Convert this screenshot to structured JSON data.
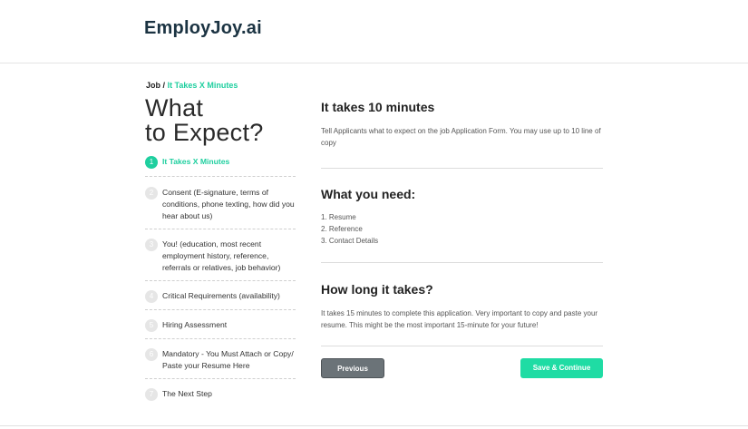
{
  "header": {
    "logo": "EmployJoy.ai"
  },
  "breadcrumb": {
    "parent": "Job",
    "separator": "/",
    "current": "It Takes X Minutes"
  },
  "page_title": {
    "line1": "What",
    "line2": "to Expect?"
  },
  "steps": [
    {
      "number": "1",
      "label": "It Takes X Minutes",
      "active": true
    },
    {
      "number": "2",
      "label": "Consent (E-signature, terms of conditions, phone texting, how  did you hear about us)",
      "active": false
    },
    {
      "number": "3",
      "label": "You! (education, most recent employment history, reference, referrals or relatives, job behavior)",
      "active": false
    },
    {
      "number": "4",
      "label": "Critical Requirements (availability)",
      "active": false
    },
    {
      "number": "5",
      "label": "Hiring Assessment",
      "active": false
    },
    {
      "number": "6",
      "label": "Mandatory - You Must Attach or Copy/ Paste your Resume Here",
      "active": false
    },
    {
      "number": "7",
      "label": "The Next Step",
      "active": false
    }
  ],
  "sections": {
    "time": {
      "title": "It takes 10 minutes",
      "body": "Tell Applicants what to expect on the job Application Form.  You may use up to 10 line of copy"
    },
    "need": {
      "title": "What you need:",
      "items": [
        "1.  Resume",
        "2. Reference",
        "3. Contact Details"
      ]
    },
    "duration": {
      "title": "How long it takes?",
      "body": "It takes 15 minutes to complete this application. Very important to  copy and paste your resume. This might be the most important  15-minute for your future!"
    }
  },
  "buttons": {
    "previous": "Previous",
    "next": "Save & Continue"
  },
  "colors": {
    "accent": "#1fcf9f",
    "button_next": "#1fdca4",
    "button_prev": "#6b7378",
    "logo": "#1b3342"
  }
}
